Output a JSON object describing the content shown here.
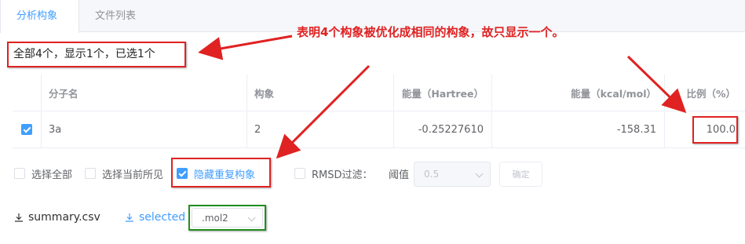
{
  "tabs": [
    {
      "label": "分析构象",
      "active": true
    },
    {
      "label": "文件列表",
      "active": false
    }
  ],
  "summary": "全部4个，显示1个，已选1个",
  "table": {
    "headers": [
      "分子名",
      "构象",
      "能量（Hartree）",
      "能量（kcal/mol）",
      "比例（%）"
    ],
    "rows": [
      {
        "checked": true,
        "name": "3a",
        "conformers": "2",
        "energy_hartree": "-0.25227610",
        "energy_kcal": "-158.31",
        "ratio": "100.0"
      }
    ]
  },
  "options": {
    "select_all": "选择全部",
    "select_visible": "选择当前所见",
    "hide_duplicates": "隐藏重复构象",
    "rmsd_filter": "RMSD过滤：",
    "threshold_label": "阈值",
    "threshold_value": "0.5",
    "confirm": "确定"
  },
  "downloads": {
    "summary_csv": "summary.csv",
    "selected": "selected",
    "format": ".mol2"
  },
  "annotation": "表明4个构象被优化成相同的构象，故只显示一个。",
  "colors": {
    "accent": "#409eff",
    "annotation_red": "#e02222",
    "highlight_green": "#1f8f1f"
  }
}
